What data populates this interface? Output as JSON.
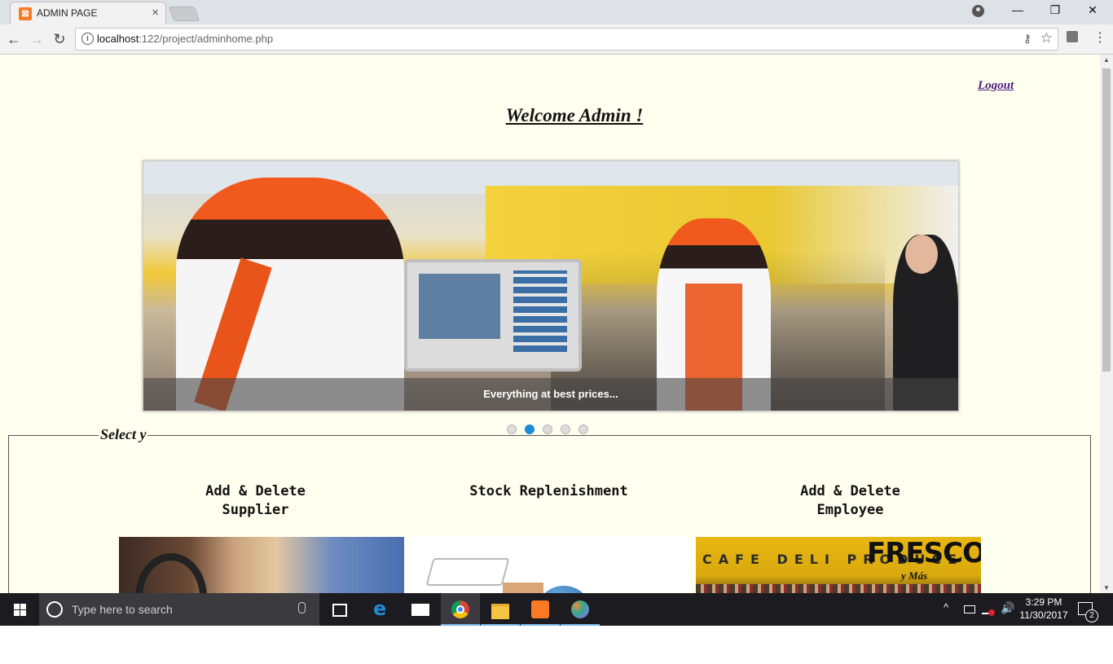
{
  "browser": {
    "tab_title": "ADMIN PAGE",
    "tab_close": "×",
    "favicon_text": "⊠",
    "url_host": "localhost",
    "url_rest": ":122/project/adminhome.php",
    "back": "←",
    "forward": "→",
    "reload": "↻",
    "info": "i",
    "key": "⚷",
    "star": "☆",
    "menu": "⋮",
    "minimize": "—",
    "restore": "❐",
    "close": "✕"
  },
  "page": {
    "logout": "Logout",
    "welcome": "Welcome Admin !",
    "slider": {
      "caption": "Everything at best prices...",
      "dots": 5,
      "active_dot": 2
    },
    "section_legend": "Select y",
    "cards": [
      {
        "title_line1": "Add & Delete",
        "title_line2": "Supplier"
      },
      {
        "title_line1": "Stock Replenishment",
        "title_line2": ""
      },
      {
        "title_line1": "Add & Delete",
        "title_line2": "Employee"
      }
    ],
    "image_text": {
      "fresco": "FRESCO",
      "ymas": "y Más",
      "signs": "CAFE  DELI  PRODUCE"
    }
  },
  "taskbar": {
    "search_placeholder": "Type here to search",
    "chevron": "^",
    "volume": "🔊",
    "time": "3:29 PM",
    "date": "11/30/2017",
    "notification_count": "2"
  },
  "colors": {
    "page_bg": "#fffff0",
    "accent_dot": "#1a8bd6",
    "logout_link": "#4b1d7a",
    "xampp_orange": "#fb7a24"
  }
}
